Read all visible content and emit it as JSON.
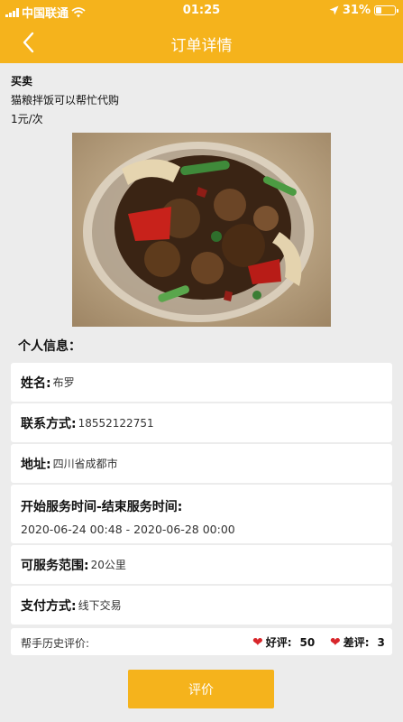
{
  "status_bar": {
    "carrier": "中国联通",
    "time": "01:25",
    "battery_pct": "31%",
    "battery_level": 0.31,
    "icons": [
      "signal-icon",
      "wifi-icon",
      "location-icon",
      "battery-icon"
    ]
  },
  "navbar": {
    "title": "订单详情",
    "back_icon": "chevron-left-icon"
  },
  "order": {
    "type": "买卖",
    "description": "猫粮拌饭可以帮忙代购",
    "price": "1元/次"
  },
  "personal": {
    "section_title": "个人信息：",
    "name_label": "姓名:",
    "name_value": "布罗",
    "phone_label": "联系方式:",
    "phone_value": "18552122751",
    "address_label": "地址:",
    "address_value": "四川省成都市",
    "service_time_label": "开始服务时间-结束服务时间:",
    "service_time_value": "2020-06-24 00:48 - 2020-06-28 00:00",
    "range_label": "可服务范围:",
    "range_value": "20公里",
    "payment_label": "支付方式:",
    "payment_value": "线下交易"
  },
  "reviews": {
    "label": "帮手历史评价:",
    "good_label": "好评:",
    "good_count": "50",
    "bad_label": "差评:",
    "bad_count": "3",
    "heart_color": "#d8262b"
  },
  "actions": {
    "evaluate_label": "评价"
  },
  "colors": {
    "brand": "#f5b31c",
    "background": "#ececec"
  }
}
